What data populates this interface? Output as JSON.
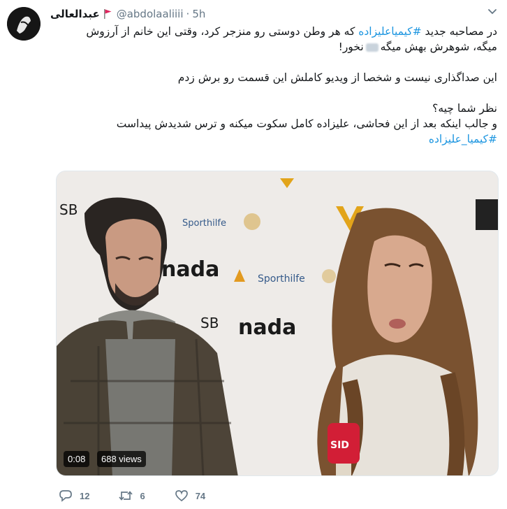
{
  "tweet": {
    "display_name": "عبدالعالی",
    "handle": "@abdolaaliiii",
    "separator": "·",
    "time": "5h",
    "lines": {
      "l1_prefix": "در مصاحبه جدید ",
      "l1_hashtag": "#کیمیاعلیزاده",
      "l1_suffix": " که هر وطن دوستی رو منزجر کرد، وقتی این خانم از آرزوش",
      "l2_prefix": "میگه، شوهرش بهش میگه",
      "l2_suffix": "نخور!",
      "l3": "این صداگذاری نیست و شخصا از ویدیو کاملش این قسمت رو برش زدم",
      "l4": "نظر شما چیه؟",
      "l5": "و جالب اینکه بعد از این فحاشی، علیزاده کامل سکوت میکنه و ترس شدیدش پیداست",
      "l6_hashtag": "#کیمیا_علیزاده"
    },
    "colors": {
      "hashtag": "#1b95e0",
      "muted": "#657786",
      "text": "#14171a"
    }
  },
  "video": {
    "duration": "0:08",
    "views": "688 views",
    "backdrop_text": {
      "nada": "nada",
      "sporthilfe": "Sporthilfe",
      "sb": "SB"
    }
  },
  "actions": {
    "replies": "12",
    "retweets": "6",
    "likes": "74"
  },
  "icons": [
    "avatar-image",
    "flag-icon",
    "chevron-down-icon",
    "reply-icon",
    "retweet-icon",
    "like-icon"
  ]
}
